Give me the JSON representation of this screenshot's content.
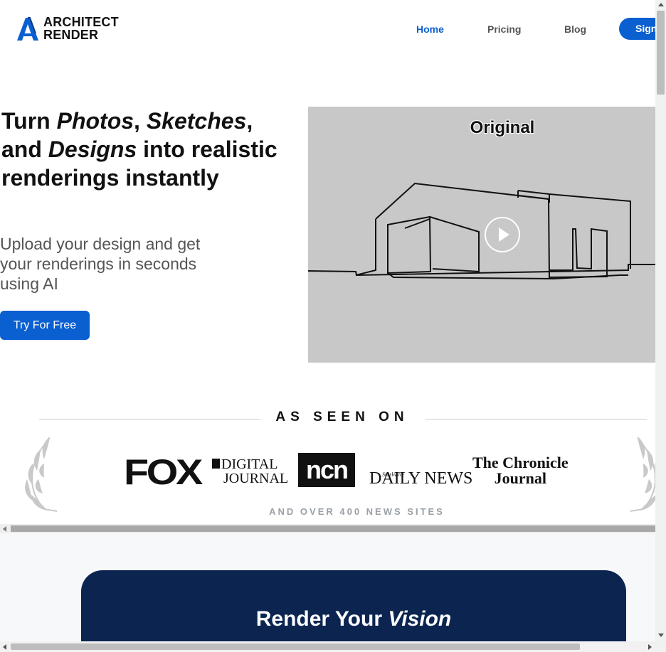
{
  "header": {
    "logo_line1": "ARCHITECT",
    "logo_line2": "RENDER",
    "nav": [
      "Home",
      "Pricing",
      "Blog"
    ],
    "signup_label": "Sign"
  },
  "hero": {
    "h_turn": "Turn ",
    "h_photos": "Photos",
    "h_comma1": ", ",
    "h_sketches": "Sketches",
    "h_comma2": ",",
    "h_and": "and ",
    "h_designs": "Designs",
    "h_rest": " into realistic renderings instantly",
    "subtitle": "Upload your design and get your renderings in seconds using AI",
    "cta_label": "Try For Free",
    "video_label": "Original"
  },
  "press": {
    "title": "AS SEEN ON",
    "logos": {
      "fox": "FOX",
      "dj1": "DIGITAL",
      "dj2": "JOURNAL",
      "ncn": "ncn",
      "ddn_small": "Starkville",
      "ddn": "DAILY NEWS",
      "chron1": "The Chronicle",
      "chron2": "Journal"
    },
    "footer": "AND OVER 400 NEWS SITES"
  },
  "cta_section": {
    "title_plain": "Render Your ",
    "title_em": "Vision"
  },
  "colors": {
    "accent": "#0a5fd1",
    "card": "#0b2550"
  }
}
